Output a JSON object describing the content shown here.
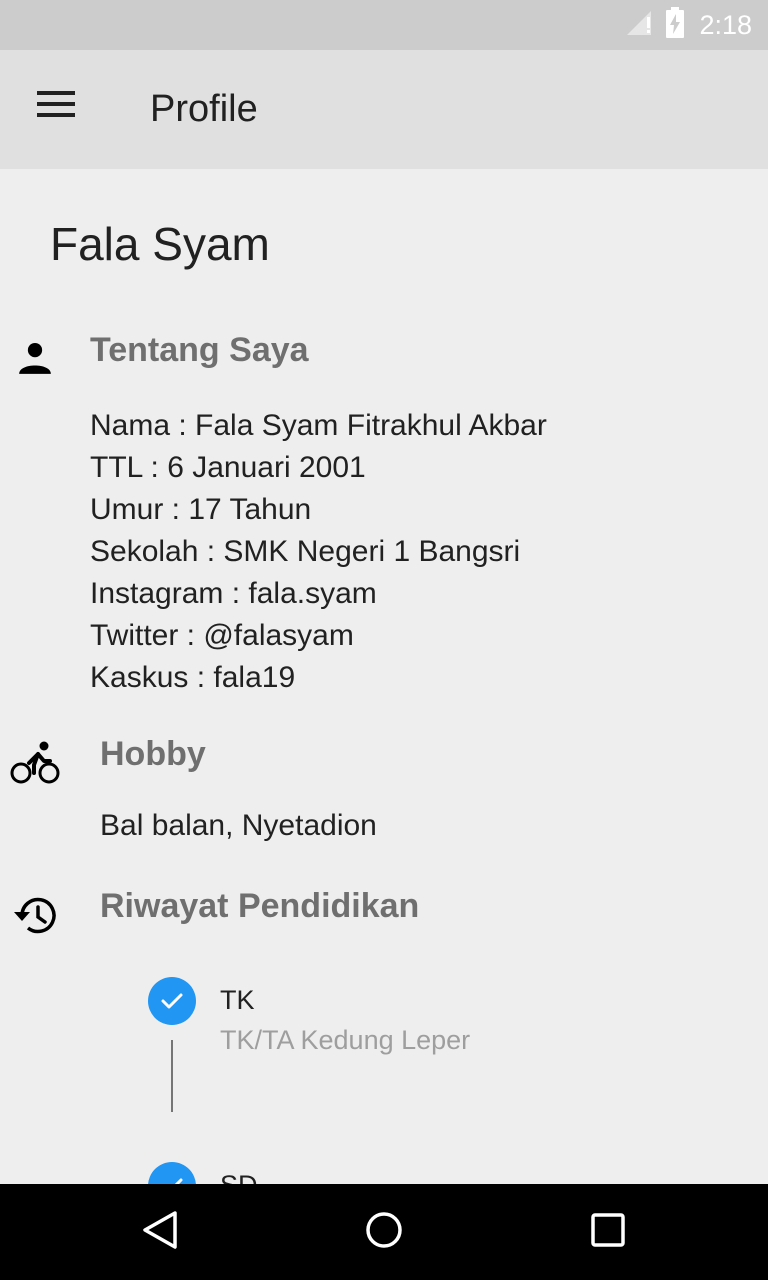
{
  "status_bar": {
    "time": "2:18",
    "icons": [
      "signal-icon",
      "battery-charging-icon"
    ]
  },
  "app_bar": {
    "title": "Profile",
    "menu_icon": "menu-icon"
  },
  "profile": {
    "name": "Fala Syam"
  },
  "about": {
    "icon": "person-icon",
    "heading": "Tentang Saya",
    "lines": [
      "Nama : Fala Syam Fitrakhul Akbar",
      "TTL : 6 Januari 2001",
      "Umur : 17 Tahun",
      "Sekolah : SMK Negeri 1 Bangsri",
      "Instagram : fala.syam",
      "Twitter : @falasyam",
      "Kaskus : fala19"
    ]
  },
  "hobby": {
    "icon": "bike-icon",
    "heading": "Hobby",
    "text": "Bal balan, Nyetadion"
  },
  "education": {
    "icon": "history-icon",
    "heading": "Riwayat Pendidikan",
    "items": [
      {
        "title": "TK",
        "subtitle": "TK/TA Kedung Leper"
      },
      {
        "title": "SD",
        "subtitle": ""
      }
    ]
  },
  "nav_bar": {
    "icons": [
      "back-icon",
      "home-icon",
      "recents-icon"
    ]
  },
  "colors": {
    "accent": "#2196f3",
    "heading": "#6f6f6f",
    "app_bar": "#e0e0e0",
    "status_bar": "#cccccc"
  }
}
